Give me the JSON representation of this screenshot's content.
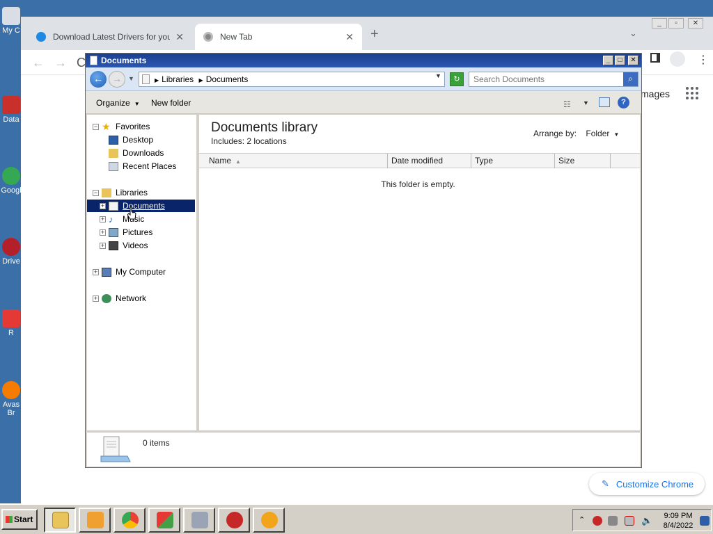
{
  "desktop": {
    "icons": [
      {
        "label": "My C"
      },
      {
        "label": "Data"
      },
      {
        "label": "Googl"
      },
      {
        "label": "Drive"
      },
      {
        "label": "R"
      },
      {
        "label": "Avas"
      },
      {
        "label": "Br"
      }
    ]
  },
  "chrome": {
    "tabs": [
      {
        "label": "Download Latest Drivers for your W",
        "active": false
      },
      {
        "label": "New Tab",
        "active": true
      }
    ],
    "new_tab": "+",
    "images_link": "mages",
    "customize_label": "Customize Chrome"
  },
  "explorer": {
    "title": "Documents",
    "breadcrumb": [
      "Libraries",
      "Documents"
    ],
    "search_placeholder": "Search Documents",
    "toolbar": {
      "organize": "Organize",
      "new_folder": "New folder"
    },
    "nav": {
      "favorites": {
        "label": "Favorites",
        "items": [
          "Desktop",
          "Downloads",
          "Recent Places"
        ]
      },
      "libraries": {
        "label": "Libraries",
        "items": [
          "Documents",
          "Music",
          "Pictures",
          "Videos"
        ]
      },
      "computer": "My Computer",
      "network": "Network"
    },
    "content": {
      "title": "Documents library",
      "includes": "Includes:  2 locations",
      "arrange_label": "Arrange by:",
      "arrange_value": "Folder",
      "columns": [
        "Name",
        "Date modified",
        "Type",
        "Size"
      ],
      "empty_message": "This folder is empty."
    },
    "details": {
      "count": "0 items"
    }
  },
  "taskbar": {
    "start": "Start",
    "clock_time": "9:09 PM",
    "clock_date": "8/4/2022"
  },
  "colors": {
    "desktop": "#3a6fa8",
    "explorer_title": "#1c3f8f",
    "selection": "#0a246a",
    "chrome_accent": "#1a73e8"
  }
}
